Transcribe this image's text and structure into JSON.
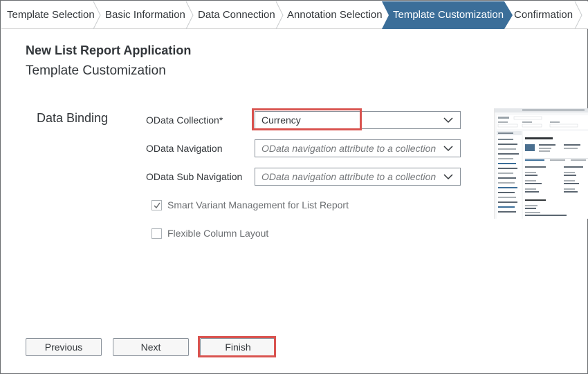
{
  "wizard": {
    "steps": [
      {
        "label": "Template Selection"
      },
      {
        "label": "Basic Information"
      },
      {
        "label": "Data Connection"
      },
      {
        "label": "Annotation Selection"
      },
      {
        "label": "Template Customization",
        "active": true
      },
      {
        "label": "Confirmation"
      }
    ]
  },
  "header": {
    "title": "New List Report Application",
    "subtitle": "Template Customization"
  },
  "data_binding": {
    "section_label": "Data Binding",
    "odata_collection": {
      "label": "OData Collection*",
      "value": "Currency"
    },
    "odata_navigation": {
      "label": "OData Navigation",
      "placeholder": "OData navigation attribute to a collection"
    },
    "odata_sub_navigation": {
      "label": "OData Sub Navigation",
      "placeholder": "OData navigation attribute to a collection"
    }
  },
  "options": {
    "smart_variant": {
      "label": "Smart Variant Management for List Report",
      "checked": true
    },
    "flexible_column": {
      "label": "Flexible Column Layout",
      "checked": false
    }
  },
  "footer": {
    "previous_label": "Previous",
    "next_label": "Next",
    "finish_label": "Finish"
  },
  "colors": {
    "active_step": "#3b6e99",
    "highlight": "#d9534f"
  }
}
